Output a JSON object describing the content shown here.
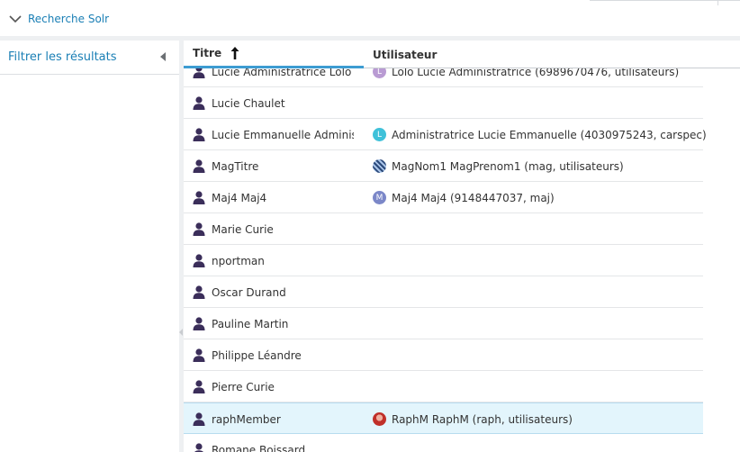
{
  "topbar": {
    "solr_label": "Recherche Solr"
  },
  "filter": {
    "title": "Filtrer les résultats"
  },
  "grid": {
    "columns": {
      "title": "Titre",
      "user": "Utilisateur"
    },
    "sort": "ascending",
    "rows": [
      {
        "title": "Lucie Administratrice Lolo",
        "user": "Lolo Lucie Administratrice (6989670476, utilisateurs)",
        "avatar": {
          "type": "initial",
          "letter": "L",
          "color": "#b99bd3"
        }
      },
      {
        "title": "Lucie Chaulet",
        "user": "",
        "avatar": null
      },
      {
        "title": "Lucie Emmanuelle Administratrice",
        "user": "Administratrice Lucie Emmanuelle (4030975243, carspec)",
        "avatar": {
          "type": "initial",
          "letter": "L",
          "color": "#3fc1d9"
        }
      },
      {
        "title": "MagTitre",
        "user": "MagNom1 MagPrenom1 (mag, utilisateurs)",
        "avatar": {
          "type": "pattern",
          "letter": "",
          "color": "#2c4a7a"
        }
      },
      {
        "title": "Maj4 Maj4",
        "user": "Maj4 Maj4 (9148447037, maj)",
        "avatar": {
          "type": "initial",
          "letter": "M",
          "color": "#7b87c8"
        }
      },
      {
        "title": "Marie Curie",
        "user": "",
        "avatar": null
      },
      {
        "title": "nportman",
        "user": "",
        "avatar": null
      },
      {
        "title": "Oscar Durand",
        "user": "",
        "avatar": null
      },
      {
        "title": "Pauline Martin",
        "user": "",
        "avatar": null
      },
      {
        "title": "Philippe Léandre",
        "user": "",
        "avatar": null
      },
      {
        "title": "Pierre Curie",
        "user": "",
        "avatar": null
      },
      {
        "title": "raphMember",
        "user": "RaphM RaphM (raph, utilisateurs)",
        "avatar": {
          "type": "photo",
          "letter": "",
          "color": "#c0302a"
        },
        "selected": true
      },
      {
        "title": "Romane Boissard",
        "user": "",
        "avatar": null
      }
    ]
  },
  "colors": {
    "accent": "#1a7fb5",
    "person_icon": "#3b2e5a",
    "selected_row": "#e3f5fc",
    "sort_underline": "#3d9cd2"
  },
  "icons": {
    "toggle": "chevron-down-icon",
    "collapse": "collapse-left-icon",
    "sort": "arrow-up-icon",
    "row": "person-icon"
  }
}
